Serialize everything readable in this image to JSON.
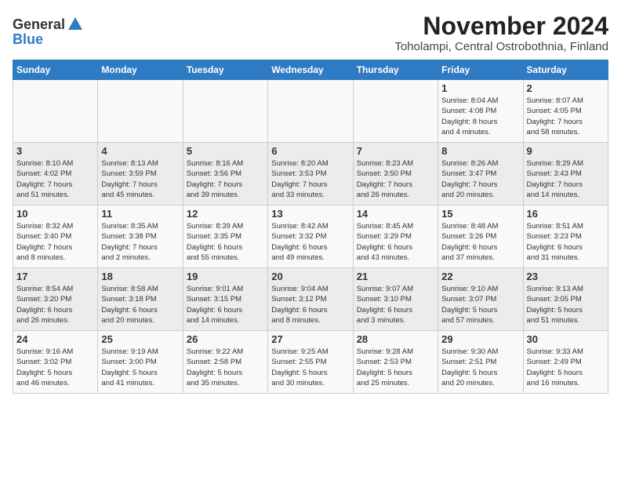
{
  "header": {
    "logo_line1": "General",
    "logo_line2": "Blue",
    "title": "November 2024",
    "subtitle": "Toholampi, Central Ostrobothnia, Finland"
  },
  "weekdays": [
    "Sunday",
    "Monday",
    "Tuesday",
    "Wednesday",
    "Thursday",
    "Friday",
    "Saturday"
  ],
  "weeks": [
    [
      {
        "day": "",
        "info": ""
      },
      {
        "day": "",
        "info": ""
      },
      {
        "day": "",
        "info": ""
      },
      {
        "day": "",
        "info": ""
      },
      {
        "day": "",
        "info": ""
      },
      {
        "day": "1",
        "info": "Sunrise: 8:04 AM\nSunset: 4:08 PM\nDaylight: 8 hours\nand 4 minutes."
      },
      {
        "day": "2",
        "info": "Sunrise: 8:07 AM\nSunset: 4:05 PM\nDaylight: 7 hours\nand 58 minutes."
      }
    ],
    [
      {
        "day": "3",
        "info": "Sunrise: 8:10 AM\nSunset: 4:02 PM\nDaylight: 7 hours\nand 51 minutes."
      },
      {
        "day": "4",
        "info": "Sunrise: 8:13 AM\nSunset: 3:59 PM\nDaylight: 7 hours\nand 45 minutes."
      },
      {
        "day": "5",
        "info": "Sunrise: 8:16 AM\nSunset: 3:56 PM\nDaylight: 7 hours\nand 39 minutes."
      },
      {
        "day": "6",
        "info": "Sunrise: 8:20 AM\nSunset: 3:53 PM\nDaylight: 7 hours\nand 33 minutes."
      },
      {
        "day": "7",
        "info": "Sunrise: 8:23 AM\nSunset: 3:50 PM\nDaylight: 7 hours\nand 26 minutes."
      },
      {
        "day": "8",
        "info": "Sunrise: 8:26 AM\nSunset: 3:47 PM\nDaylight: 7 hours\nand 20 minutes."
      },
      {
        "day": "9",
        "info": "Sunrise: 8:29 AM\nSunset: 3:43 PM\nDaylight: 7 hours\nand 14 minutes."
      }
    ],
    [
      {
        "day": "10",
        "info": "Sunrise: 8:32 AM\nSunset: 3:40 PM\nDaylight: 7 hours\nand 8 minutes."
      },
      {
        "day": "11",
        "info": "Sunrise: 8:35 AM\nSunset: 3:38 PM\nDaylight: 7 hours\nand 2 minutes."
      },
      {
        "day": "12",
        "info": "Sunrise: 8:39 AM\nSunset: 3:35 PM\nDaylight: 6 hours\nand 55 minutes."
      },
      {
        "day": "13",
        "info": "Sunrise: 8:42 AM\nSunset: 3:32 PM\nDaylight: 6 hours\nand 49 minutes."
      },
      {
        "day": "14",
        "info": "Sunrise: 8:45 AM\nSunset: 3:29 PM\nDaylight: 6 hours\nand 43 minutes."
      },
      {
        "day": "15",
        "info": "Sunrise: 8:48 AM\nSunset: 3:26 PM\nDaylight: 6 hours\nand 37 minutes."
      },
      {
        "day": "16",
        "info": "Sunrise: 8:51 AM\nSunset: 3:23 PM\nDaylight: 6 hours\nand 31 minutes."
      }
    ],
    [
      {
        "day": "17",
        "info": "Sunrise: 8:54 AM\nSunset: 3:20 PM\nDaylight: 6 hours\nand 26 minutes."
      },
      {
        "day": "18",
        "info": "Sunrise: 8:58 AM\nSunset: 3:18 PM\nDaylight: 6 hours\nand 20 minutes."
      },
      {
        "day": "19",
        "info": "Sunrise: 9:01 AM\nSunset: 3:15 PM\nDaylight: 6 hours\nand 14 minutes."
      },
      {
        "day": "20",
        "info": "Sunrise: 9:04 AM\nSunset: 3:12 PM\nDaylight: 6 hours\nand 8 minutes."
      },
      {
        "day": "21",
        "info": "Sunrise: 9:07 AM\nSunset: 3:10 PM\nDaylight: 6 hours\nand 3 minutes."
      },
      {
        "day": "22",
        "info": "Sunrise: 9:10 AM\nSunset: 3:07 PM\nDaylight: 5 hours\nand 57 minutes."
      },
      {
        "day": "23",
        "info": "Sunrise: 9:13 AM\nSunset: 3:05 PM\nDaylight: 5 hours\nand 51 minutes."
      }
    ],
    [
      {
        "day": "24",
        "info": "Sunrise: 9:16 AM\nSunset: 3:02 PM\nDaylight: 5 hours\nand 46 minutes."
      },
      {
        "day": "25",
        "info": "Sunrise: 9:19 AM\nSunset: 3:00 PM\nDaylight: 5 hours\nand 41 minutes."
      },
      {
        "day": "26",
        "info": "Sunrise: 9:22 AM\nSunset: 2:58 PM\nDaylight: 5 hours\nand 35 minutes."
      },
      {
        "day": "27",
        "info": "Sunrise: 9:25 AM\nSunset: 2:55 PM\nDaylight: 5 hours\nand 30 minutes."
      },
      {
        "day": "28",
        "info": "Sunrise: 9:28 AM\nSunset: 2:53 PM\nDaylight: 5 hours\nand 25 minutes."
      },
      {
        "day": "29",
        "info": "Sunrise: 9:30 AM\nSunset: 2:51 PM\nDaylight: 5 hours\nand 20 minutes."
      },
      {
        "day": "30",
        "info": "Sunrise: 9:33 AM\nSunset: 2:49 PM\nDaylight: 5 hours\nand 16 minutes."
      }
    ]
  ]
}
